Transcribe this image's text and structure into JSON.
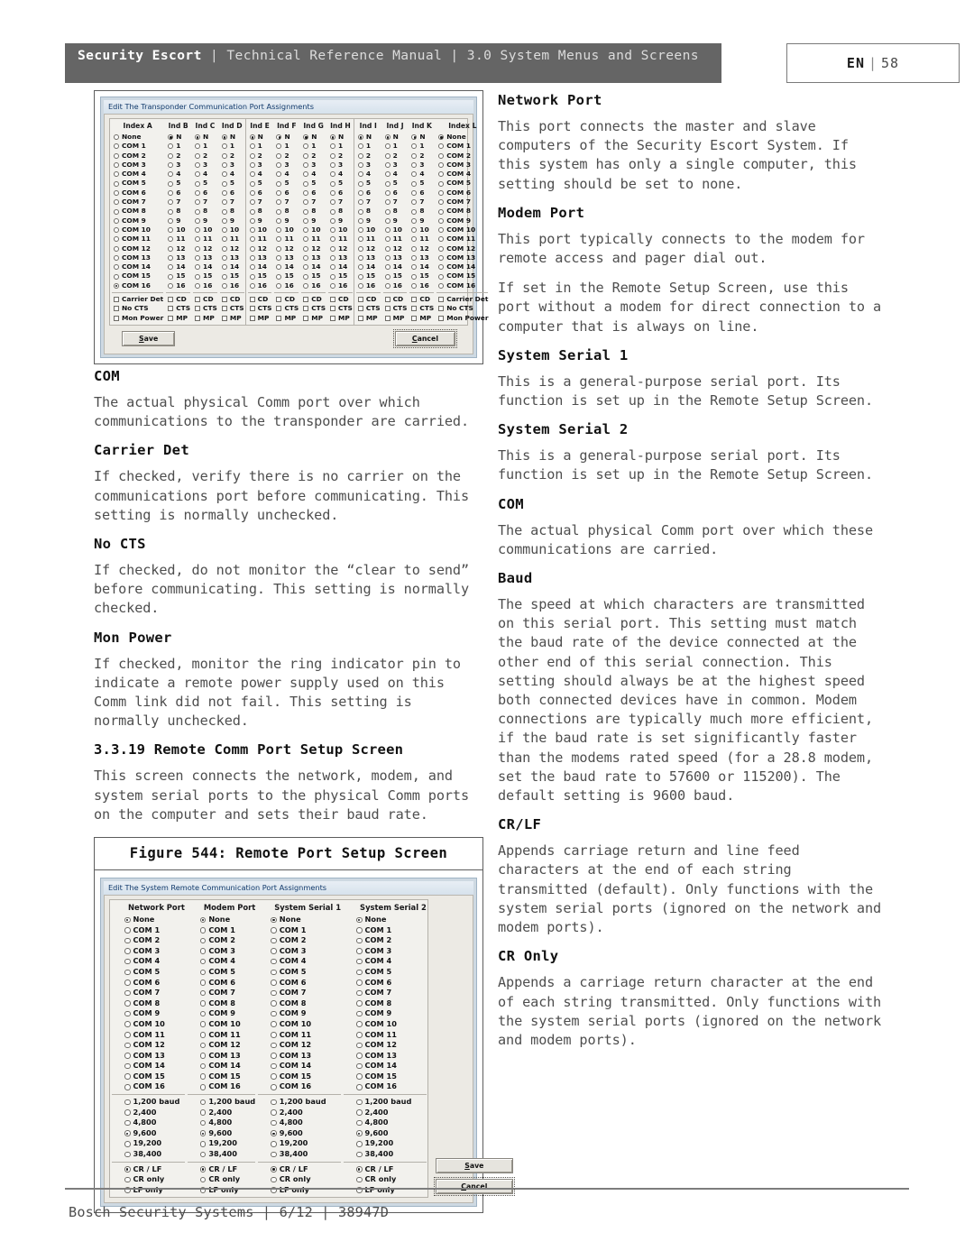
{
  "header": {
    "brand": "Security Escort",
    "separator": "|",
    "manual": "Technical Reference Manual",
    "section": "3.0  System Menus and Screens",
    "title_line": "Technical Reference Manual | 3.0  System Menus and Screens",
    "language": "EN",
    "page_number": "58"
  },
  "footer": {
    "text": "Bosch Security Systems | 6/12 | 38947D"
  },
  "figure_transponder": {
    "dialog_title": "Edit The Transponder Communication Port Assignments",
    "column_headers": [
      "Index A",
      "Ind B",
      "Ind C",
      "Ind D",
      "Ind E",
      "Ind F",
      "Ind G",
      "Ind H",
      "Ind I",
      "Ind J",
      "Ind K",
      "Index L"
    ],
    "first_option_wide": "None",
    "first_option_narrow": "N",
    "com_labels_wide": [
      "COM 1",
      "COM 2",
      "COM 3",
      "COM 4",
      "COM 5",
      "COM 6",
      "COM 7",
      "COM 8",
      "COM 9",
      "COM 10",
      "COM 11",
      "COM 12",
      "COM 13",
      "COM 14",
      "COM 15",
      "COM 16"
    ],
    "com_labels_narrow": [
      "1",
      "2",
      "3",
      "4",
      "5",
      "6",
      "7",
      "8",
      "9",
      "10",
      "11",
      "12",
      "13",
      "14",
      "15",
      "16"
    ],
    "selected_wide": "COM 16",
    "selected_narrow": "N",
    "checkboxes_wide": [
      "Carrier Det",
      "No CTS",
      "Mon Power"
    ],
    "checkboxes_narrow": [
      "CD",
      "CTS",
      "MP"
    ],
    "save_label": "Save",
    "cancel_label": "Cancel"
  },
  "figure_remote": {
    "caption": "Figure 544: Remote Port Setup Screen",
    "dialog_title": "Edit The System Remote Communication Port Assignments",
    "column_headers": [
      "Network Port",
      "Modem Port",
      "System Serial 1",
      "System Serial 2"
    ],
    "none_label": "None",
    "com_labels": [
      "COM 1",
      "COM 2",
      "COM 3",
      "COM 4",
      "COM 5",
      "COM 6",
      "COM 7",
      "COM 8",
      "COM 9",
      "COM 10",
      "COM 11",
      "COM 12",
      "COM 13",
      "COM 14",
      "COM 15",
      "COM 16"
    ],
    "baud_labels": [
      "1,200 baud",
      "2,400",
      "4,800",
      "9,600",
      "19,200",
      "38,400"
    ],
    "baud_selected": "9,600",
    "eol_labels": [
      "CR / LF",
      "CR only",
      "LF only"
    ],
    "eol_selected": "CR / LF",
    "port_selected": "None",
    "save_label": "Save",
    "cancel_label": "Cancel"
  },
  "left_column": {
    "com_heading": "COM",
    "com_body": "The actual physical Comm port over which communications to the transponder are carried.",
    "carrier_det_heading": "Carrier Det",
    "carrier_det_body": "If checked, verify there is no carrier on the communications port before communicating. This setting is normally unchecked.",
    "no_cts_heading": "No CTS",
    "no_cts_body": "If checked, do not monitor the “clear to send” before communicating. This setting is normally checked.",
    "mon_power_heading": "Mon Power",
    "mon_power_body": "If checked, monitor the ring indicator pin to indicate a remote power supply used on this Comm link did not fail. This setting is normally unchecked.",
    "section_heading": "3.3.19 Remote Comm Port Setup Screen",
    "section_body": "This screen connects the network, modem, and system serial ports to the physical Comm ports on the computer and sets their baud rate."
  },
  "right_column": {
    "network_port_heading": "Network Port",
    "network_port_body": "This port connects the master and slave computers of the Security Escort System. If this system has only a single computer, this setting should be set to none.",
    "modem_port_heading": "Modem Port",
    "modem_port_body": "This port typically connects to the modem for remote access and pager dial out.",
    "modem_port_body2": "If set in the Remote Setup Screen, use this port without a modem for direct connection to a computer that is always on line.",
    "system_serial_1_heading": "System Serial 1",
    "system_serial_1_body": "This is a general-purpose serial port. Its function is set up in the Remote Setup Screen.",
    "system_serial_2_heading": "System Serial 2",
    "system_serial_2_body": "This is a general-purpose serial port. Its function is set up in the Remote Setup Screen.",
    "com_heading": "COM",
    "com_body": "The actual physical Comm port over which these communications are carried.",
    "baud_heading": "Baud",
    "baud_body": "The speed at which characters are transmitted on this serial port. This setting must match the baud rate of the device connected at the other end of this serial connection. This setting should always be at the highest speed both connected devices have in common. Modem connections are typically much more efficient, if the baud rate is set significantly faster than the modems rated speed (for a 28.8 modem, set the baud rate to 57600 or 115200). The default setting is 9600 baud.",
    "crlf_heading": "CR/LF",
    "crlf_body": "Appends carriage return and line feed characters at the end of each string transmitted (default). Only functions with the system serial ports (ignored on the network and modem ports).",
    "cronly_heading": "CR Only",
    "cronly_body": "Appends a carriage return character at the end of each string transmitted. Only functions with the system serial ports (ignored on the network and modem ports)."
  }
}
